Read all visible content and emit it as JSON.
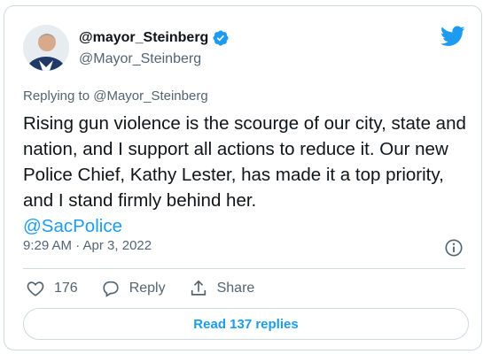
{
  "author": {
    "display_name": "@mayor_Steinberg",
    "handle": "@Mayor_Steinberg",
    "verified": true
  },
  "reply_context": {
    "prefix": "Replying to",
    "handle": "@Mayor_Steinberg"
  },
  "tweet": {
    "text": "Rising gun violence is the scourge of our city, state and nation, and I support all actions to reduce it. Our new Police Chief, Kathy Lester, has made it a top priority, and I stand firmly behind her.",
    "mention": "@SacPolice",
    "timestamp": "9:29 AM · Apr 3, 2022"
  },
  "actions": {
    "like_count": "176",
    "reply_label": "Reply",
    "share_label": "Share"
  },
  "read_replies_label": "Read 137 replies",
  "colors": {
    "accent": "#1d9bf0",
    "muted": "#536471",
    "text": "#0f1419",
    "border": "#cfd9de"
  },
  "icons": [
    "twitter-bird-icon",
    "verified-badge-icon",
    "info-icon",
    "heart-icon",
    "reply-icon",
    "share-icon"
  ]
}
